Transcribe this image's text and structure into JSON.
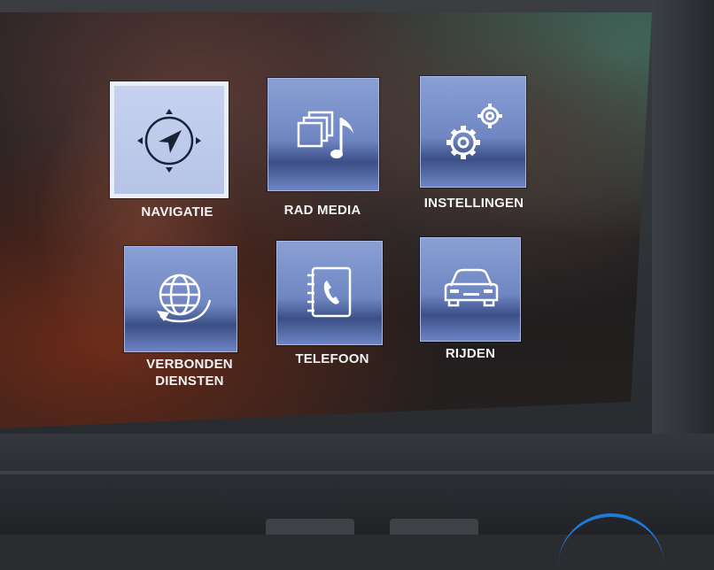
{
  "menu": {
    "items": [
      {
        "label": "NAVIGATIE",
        "icon": "compass-icon",
        "selected": true
      },
      {
        "label": "RAD MEDIA",
        "icon": "media-music-icon",
        "selected": false
      },
      {
        "label": "INSTELLINGEN",
        "icon": "gears-icon",
        "selected": false
      },
      {
        "label_line1": "VERBONDEN",
        "label_line2": "DIENSTEN",
        "icon": "globe-connected-icon",
        "selected": false
      },
      {
        "label": "TELEFOON",
        "icon": "phone-book-icon",
        "selected": false
      },
      {
        "label": "RIJDEN",
        "icon": "car-icon",
        "selected": false
      }
    ]
  },
  "colors": {
    "tile": "#7890cc",
    "tile_selected": "#c6d2ee",
    "label": "#f2f2f2"
  }
}
